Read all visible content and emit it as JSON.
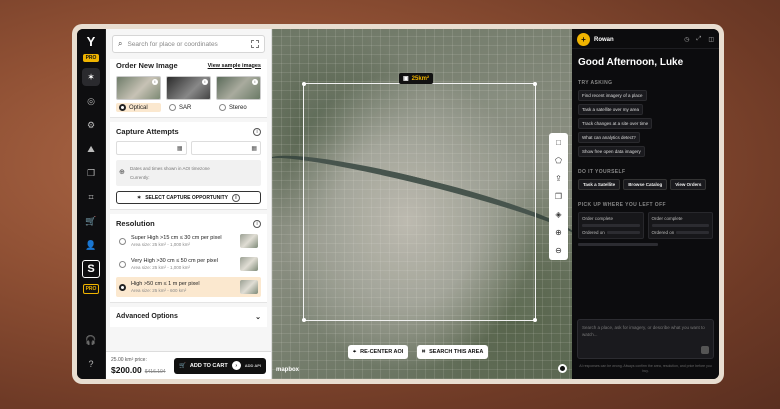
{
  "rail": {
    "logo": "Y",
    "pro": "PRO",
    "s_badge": "S",
    "pro_bottom": "PRO"
  },
  "order": {
    "search_placeholder": "Search for place or coordinates",
    "title": "Order New Image",
    "view_samples": "View sample images",
    "types": [
      {
        "label": "Optical",
        "selected": true
      },
      {
        "label": "SAR",
        "selected": false
      },
      {
        "label": "Stereo",
        "selected": false
      }
    ],
    "capture_title": "Capture Attempts",
    "tz_note": "Dates and times shown in AOI timezone",
    "tz_current": "Currently:",
    "capture_button": "SELECT CAPTURE OPPORTUNITY",
    "resolution_title": "Resolution",
    "resolutions": [
      {
        "name": "Super High >15 cm ≤ 30 cm per pixel",
        "sub": "Area size: 25 km² - 1,000 km²",
        "selected": false
      },
      {
        "name": "Very High >30 cm ≤ 50 cm per pixel",
        "sub": "Area size: 25 km² - 1,000 km²",
        "selected": false
      },
      {
        "name": "High >50 cm ≤ 1 m per pixel",
        "sub": "Area size: 25 km² - 600 km²",
        "selected": true
      }
    ],
    "advanced": "Advanced Options",
    "price_label": "25.00 km² price:",
    "price": "$200.00",
    "price_old": "$416.104",
    "cart_button": "ADD TO CART",
    "add_api": "ADD API"
  },
  "map": {
    "area": "25km²",
    "recenter": "RE-CENTER AOI",
    "search_area": "SEARCH THIS AREA",
    "attribution": "mapbox"
  },
  "assistant": {
    "name": "Rowan",
    "greeting": "Good Afternoon, Luke",
    "try_asking": "TRY ASKING",
    "suggestions": [
      "Find recent imagery of a place",
      "Task a satellite over my area",
      "Track changes at a site over time",
      "What can analytics detect?",
      "Show free open data imagery"
    ],
    "diy_title": "DO IT YOURSELF",
    "diy": [
      "Task a Satellite",
      "Browse Catalog",
      "View Orders"
    ],
    "pickup_title": "PICK UP WHERE YOU LEFT OFF",
    "cards": [
      {
        "status": "Order complete",
        "ordered": "Ordered on"
      },
      {
        "status": "Order complete",
        "ordered": "Ordered on"
      }
    ],
    "chat_placeholder": "Search a place, ask for imagery, or describe what you want to watch...",
    "disclaimer": "AI responses can be wrong. Always confirm the area, resolution, and price before you buy."
  },
  "colors": {
    "accent": "#f0b400",
    "selection": "#fbe8cf",
    "dark": "#0c0c0e"
  }
}
